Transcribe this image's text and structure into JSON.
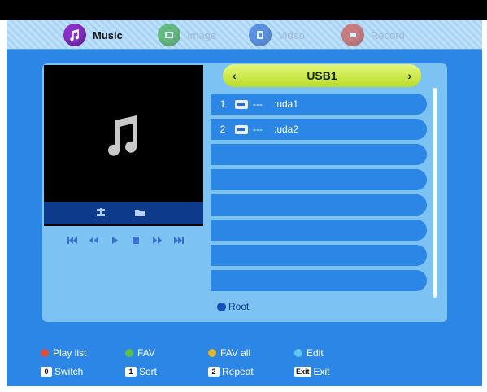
{
  "tabs": [
    {
      "label": "Music",
      "active": true,
      "icon": "music-note-icon",
      "color": "#8b2fc9"
    },
    {
      "label": "Image",
      "active": false,
      "icon": "image-icon",
      "color": "#2fa82f"
    },
    {
      "label": "Video",
      "active": false,
      "icon": "video-icon",
      "color": "#1f62d6"
    },
    {
      "label": "Record",
      "active": false,
      "icon": "record-icon",
      "color": "#d93f2e"
    }
  ],
  "preview": {
    "icon": "music-note-icon"
  },
  "usb": {
    "title": "USB1",
    "left_arrow": "‹",
    "right_arrow": "›"
  },
  "files": [
    {
      "num": "1",
      "dots": "---",
      "name": ":uda1"
    },
    {
      "num": "2",
      "dots": "---",
      "name": ":uda2"
    }
  ],
  "root_label": "Root",
  "footer": {
    "play_list": "Play list",
    "fav": "FAV",
    "fav_all": "FAV all",
    "edit": "Edit",
    "switch_key": "0",
    "switch_label": "Switch",
    "sort_key": "1",
    "sort_label": "Sort",
    "repeat_key": "2",
    "repeat_label": "Repeat",
    "exit_key": "Exit",
    "exit_label": "Exit"
  },
  "colors": {
    "background": "#2b86e6",
    "panel": "#7cc2f2",
    "header": "#d3ef4a",
    "red": "#e24c3a",
    "green": "#5bc04a",
    "yellow": "#e0b42a",
    "blue": "#5cc8f0"
  }
}
